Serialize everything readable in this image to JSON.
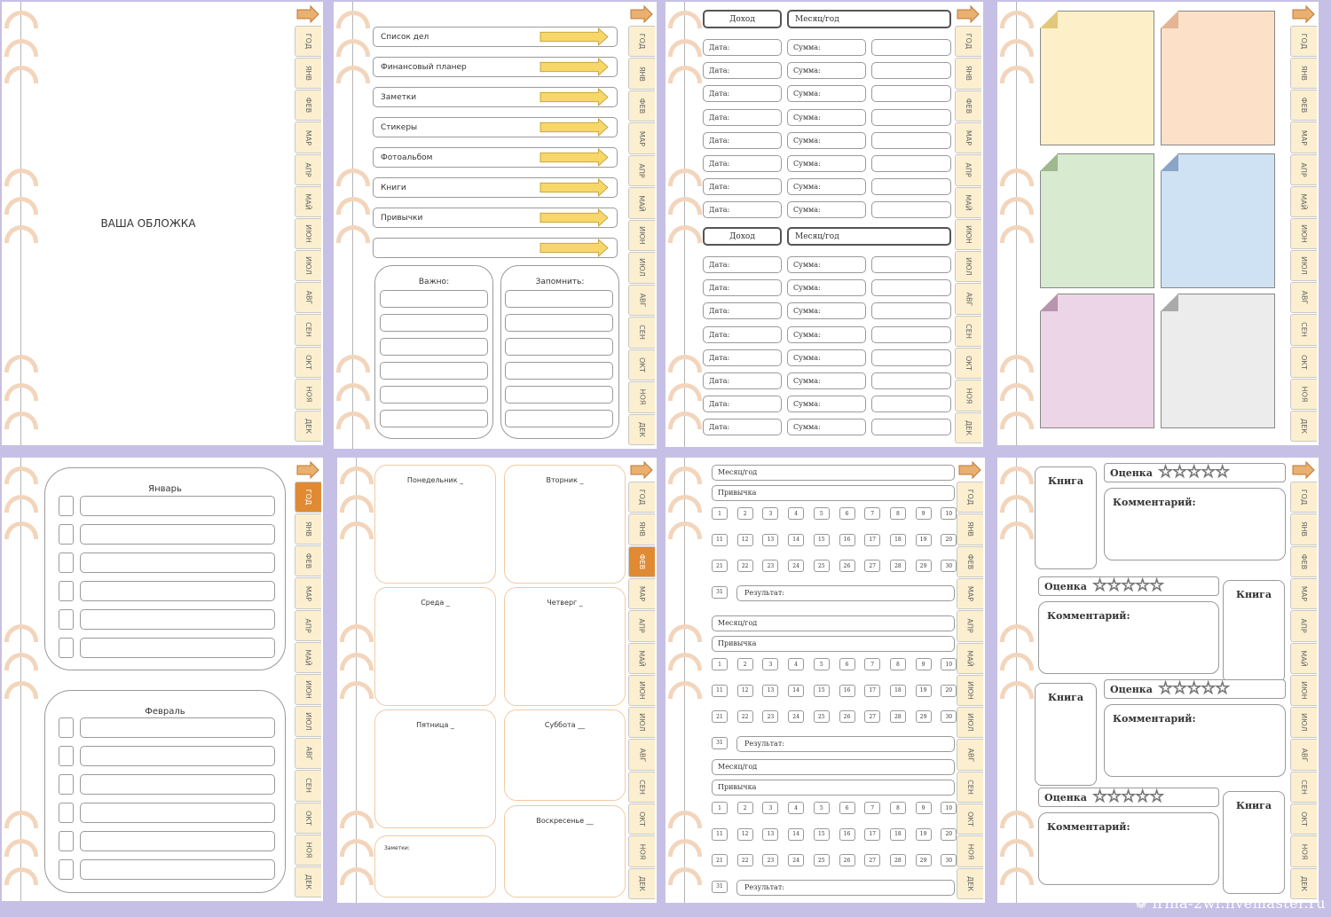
{
  "months": [
    "ГОД",
    "ЯНВ",
    "ФЕВ",
    "МАР",
    "АПР",
    "МАЙ",
    "ИЮН",
    "ИЮЛ",
    "АВГ",
    "СЕН",
    "ОКТ",
    "НОЯ",
    "ДЕК"
  ],
  "colors": {
    "background": "#c7c0e6",
    "tab": "#fbefcf",
    "tab_active": "#e08a33",
    "ring": "#f3d5bc",
    "arrow": "#f7d76a"
  },
  "cover": {
    "title": "ВАША ОБЛОЖКА"
  },
  "menu": {
    "items": [
      "Список дел",
      "Финансовый планер",
      "Заметки",
      "Стикеры",
      "Фотоальбом",
      "Книги",
      "Привычки",
      ""
    ],
    "important": "Важно:",
    "remember": "Запомнить:"
  },
  "finance": {
    "income": "Доход",
    "month_year": "Месяц/год",
    "date": "Дата:",
    "sum": "Сумма:"
  },
  "stickers": {
    "colors": [
      "#fdf0c8",
      "#fde0c8",
      "#d8ead0",
      "#cfe2f3",
      "#ecd5e6",
      "#ececec"
    ],
    "fold_colors": [
      "#e2c87a",
      "#e2b595",
      "#9fb98f",
      "#8aa5c5",
      "#b894ad",
      "#aaaaaa"
    ]
  },
  "todo": {
    "january": "Январь",
    "february": "Февраль"
  },
  "week": {
    "monday": "Понедельник _",
    "tuesday": "Вторник _",
    "wednesday": "Среда _",
    "thursday": "Четверг _",
    "friday": "Пятница _",
    "saturday": "Суббота __",
    "sunday": "Воскресенье __",
    "notes": "Заметки:"
  },
  "habits": {
    "month_year": "Месяц/год",
    "habit": "Привычка",
    "result": "Результат:"
  },
  "books": {
    "book": "Книга",
    "rating": "Оценка",
    "comment": "Комментарий:",
    "stars": "☆☆☆☆☆"
  },
  "watermark": "❁ irina-2wi.livemaster.ru"
}
